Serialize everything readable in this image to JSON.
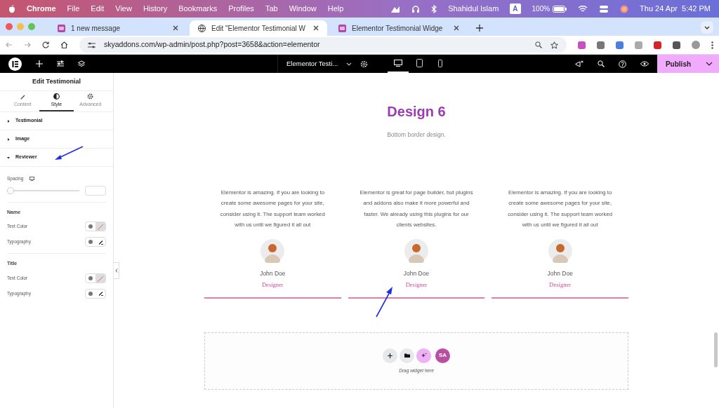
{
  "menu_bar": {
    "app": "Chrome",
    "items": [
      "File",
      "Edit",
      "View",
      "History",
      "Bookmarks",
      "Profiles",
      "Tab",
      "Window",
      "Help"
    ],
    "user": "Shahidul Islam",
    "input_source": "A",
    "battery": "100%",
    "clock": "Thu 24 Apr  5:42 PM"
  },
  "browser_tabs": [
    {
      "title": "1 new message",
      "selected": false
    },
    {
      "title": "Edit \"Elementor Testimonial W",
      "selected": true
    },
    {
      "title": "Elementor Testimonial Widge",
      "selected": false
    }
  ],
  "address_bar": {
    "url": "skyaddons.com/wp-admin/post.php?post=3658&action=elementor"
  },
  "editor_bar": {
    "document": "Elementor Testi...",
    "devices": [
      {
        "kind": "desktop",
        "selected": true
      },
      {
        "kind": "tablet",
        "selected": false
      },
      {
        "kind": "mobile",
        "selected": false
      }
    ],
    "publish": "Publish"
  },
  "panel": {
    "title": "Edit Testimonial",
    "tabs": [
      {
        "label": "Content",
        "selected": false
      },
      {
        "label": "Style",
        "selected": true
      },
      {
        "label": "Advanced",
        "selected": false
      }
    ],
    "sections": [
      {
        "label": "Testimonial",
        "expanded": false
      },
      {
        "label": "Image",
        "expanded": false
      },
      {
        "label": "Reviewer",
        "expanded": true
      }
    ],
    "spacing": {
      "label": "Spacing",
      "level": 0
    },
    "groups": [
      {
        "heading": "Name",
        "controls": [
          {
            "label": "Text Color",
            "kind": "color"
          },
          {
            "label": "Typography",
            "kind": "typography"
          }
        ]
      },
      {
        "heading": "Title",
        "controls": [
          {
            "label": "Text Color",
            "kind": "color"
          },
          {
            "label": "Typography",
            "kind": "typography"
          }
        ]
      }
    ]
  },
  "canvas": {
    "heading": "Design 6",
    "subheading": "Bottom border design.",
    "testimonials": [
      {
        "text": "Elementor is amazing. If you are looking to create some awesome pages for your site, consider using it. The support team worked with us until we figured it all out",
        "name": "John Doe",
        "title": "Designer"
      },
      {
        "text": "Elementor is great for page builder, but plugins and addons also make it more powerful and faster. We already using this plugins for our clients websites.",
        "name": "John Doe",
        "title": "Designer"
      },
      {
        "text": "Elementor is amazing. If you are looking to create some awesome pages for your site, consider using it. The support team worked with us until we figured it all out",
        "name": "John Doe",
        "title": "Designer"
      }
    ],
    "drop_zone": {
      "logo_text": "SA",
      "hint": "Drag widget here"
    }
  }
}
